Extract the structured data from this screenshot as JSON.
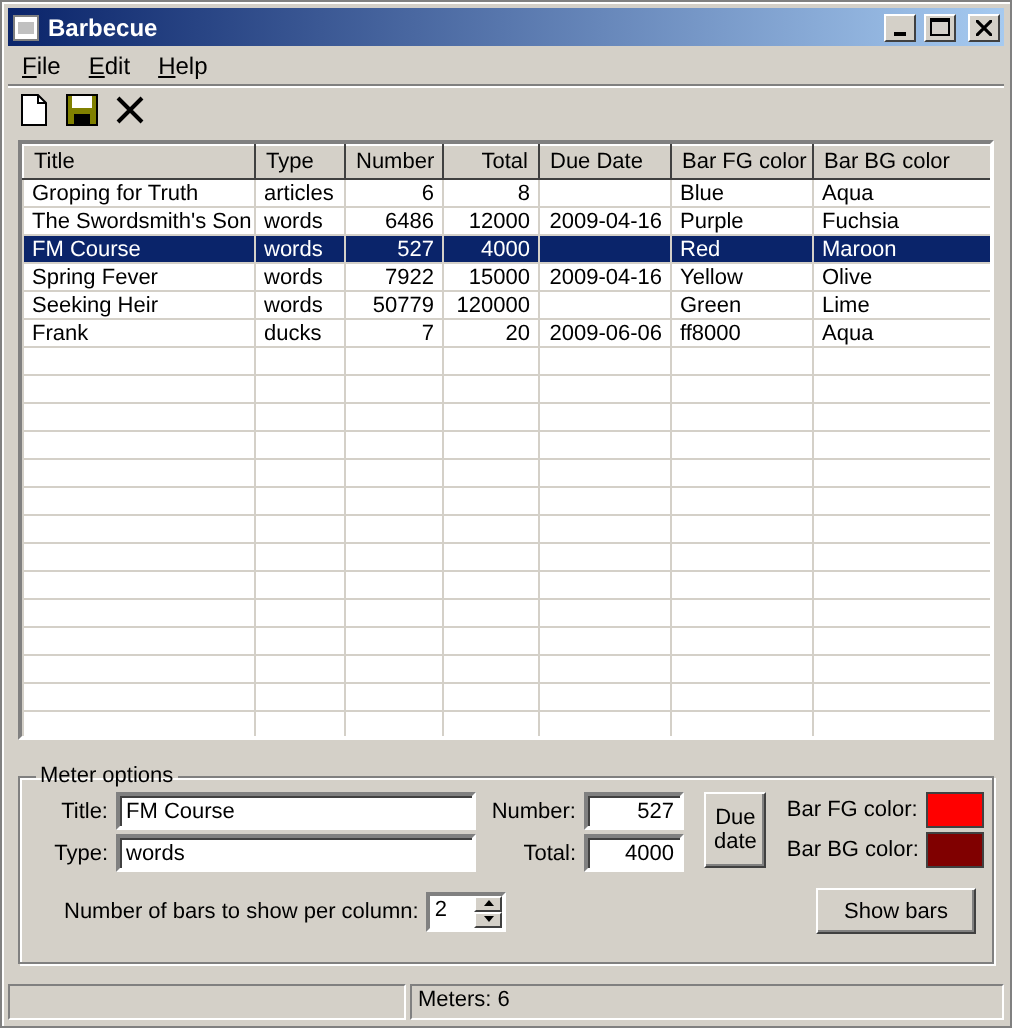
{
  "window": {
    "title": "Barbecue"
  },
  "menu": [
    "File",
    "Edit",
    "Help"
  ],
  "table": {
    "columns": [
      "Title",
      "Type",
      "Number",
      "Total",
      "Due Date",
      "Bar FG color",
      "Bar BG color"
    ],
    "rows": [
      {
        "cells": [
          "Groping for Truth",
          "articles",
          "6",
          "8",
          "",
          "Blue",
          "Aqua"
        ],
        "selected": false
      },
      {
        "cells": [
          "The Swordsmith's Son",
          "words",
          "6486",
          "12000",
          "2009-04-16",
          "Purple",
          "Fuchsia"
        ],
        "selected": false
      },
      {
        "cells": [
          "FM Course",
          "words",
          "527",
          "4000",
          "",
          "Red",
          "Maroon"
        ],
        "selected": true
      },
      {
        "cells": [
          "Spring Fever",
          "words",
          "7922",
          "15000",
          "2009-04-16",
          "Yellow",
          "Olive"
        ],
        "selected": false
      },
      {
        "cells": [
          "Seeking Heir",
          "words",
          "50779",
          "120000",
          "",
          "Green",
          "Lime"
        ],
        "selected": false
      },
      {
        "cells": [
          "Frank",
          "ducks",
          "7",
          "20",
          "2009-06-06",
          "ff8000",
          "Aqua"
        ],
        "selected": false
      }
    ]
  },
  "meter_options": {
    "title": "Meter options",
    "title_label": "Title:",
    "title_value": "FM Course",
    "type_label": "Type:",
    "type_value": "words",
    "number_label": "Number:",
    "number_value": "527",
    "total_label": "Total:",
    "total_value": "4000",
    "due_button": "Due date",
    "swatches": [
      {
        "label": "Bar FG color:",
        "color": "#ff0000"
      },
      {
        "label": "Bar BG color:",
        "color": "#800000"
      }
    ],
    "bars_label": "Number of bars to show per column:",
    "bars_value": "2",
    "show_button": "Show bars"
  },
  "status_bar": {
    "text": "Meters: 6"
  }
}
